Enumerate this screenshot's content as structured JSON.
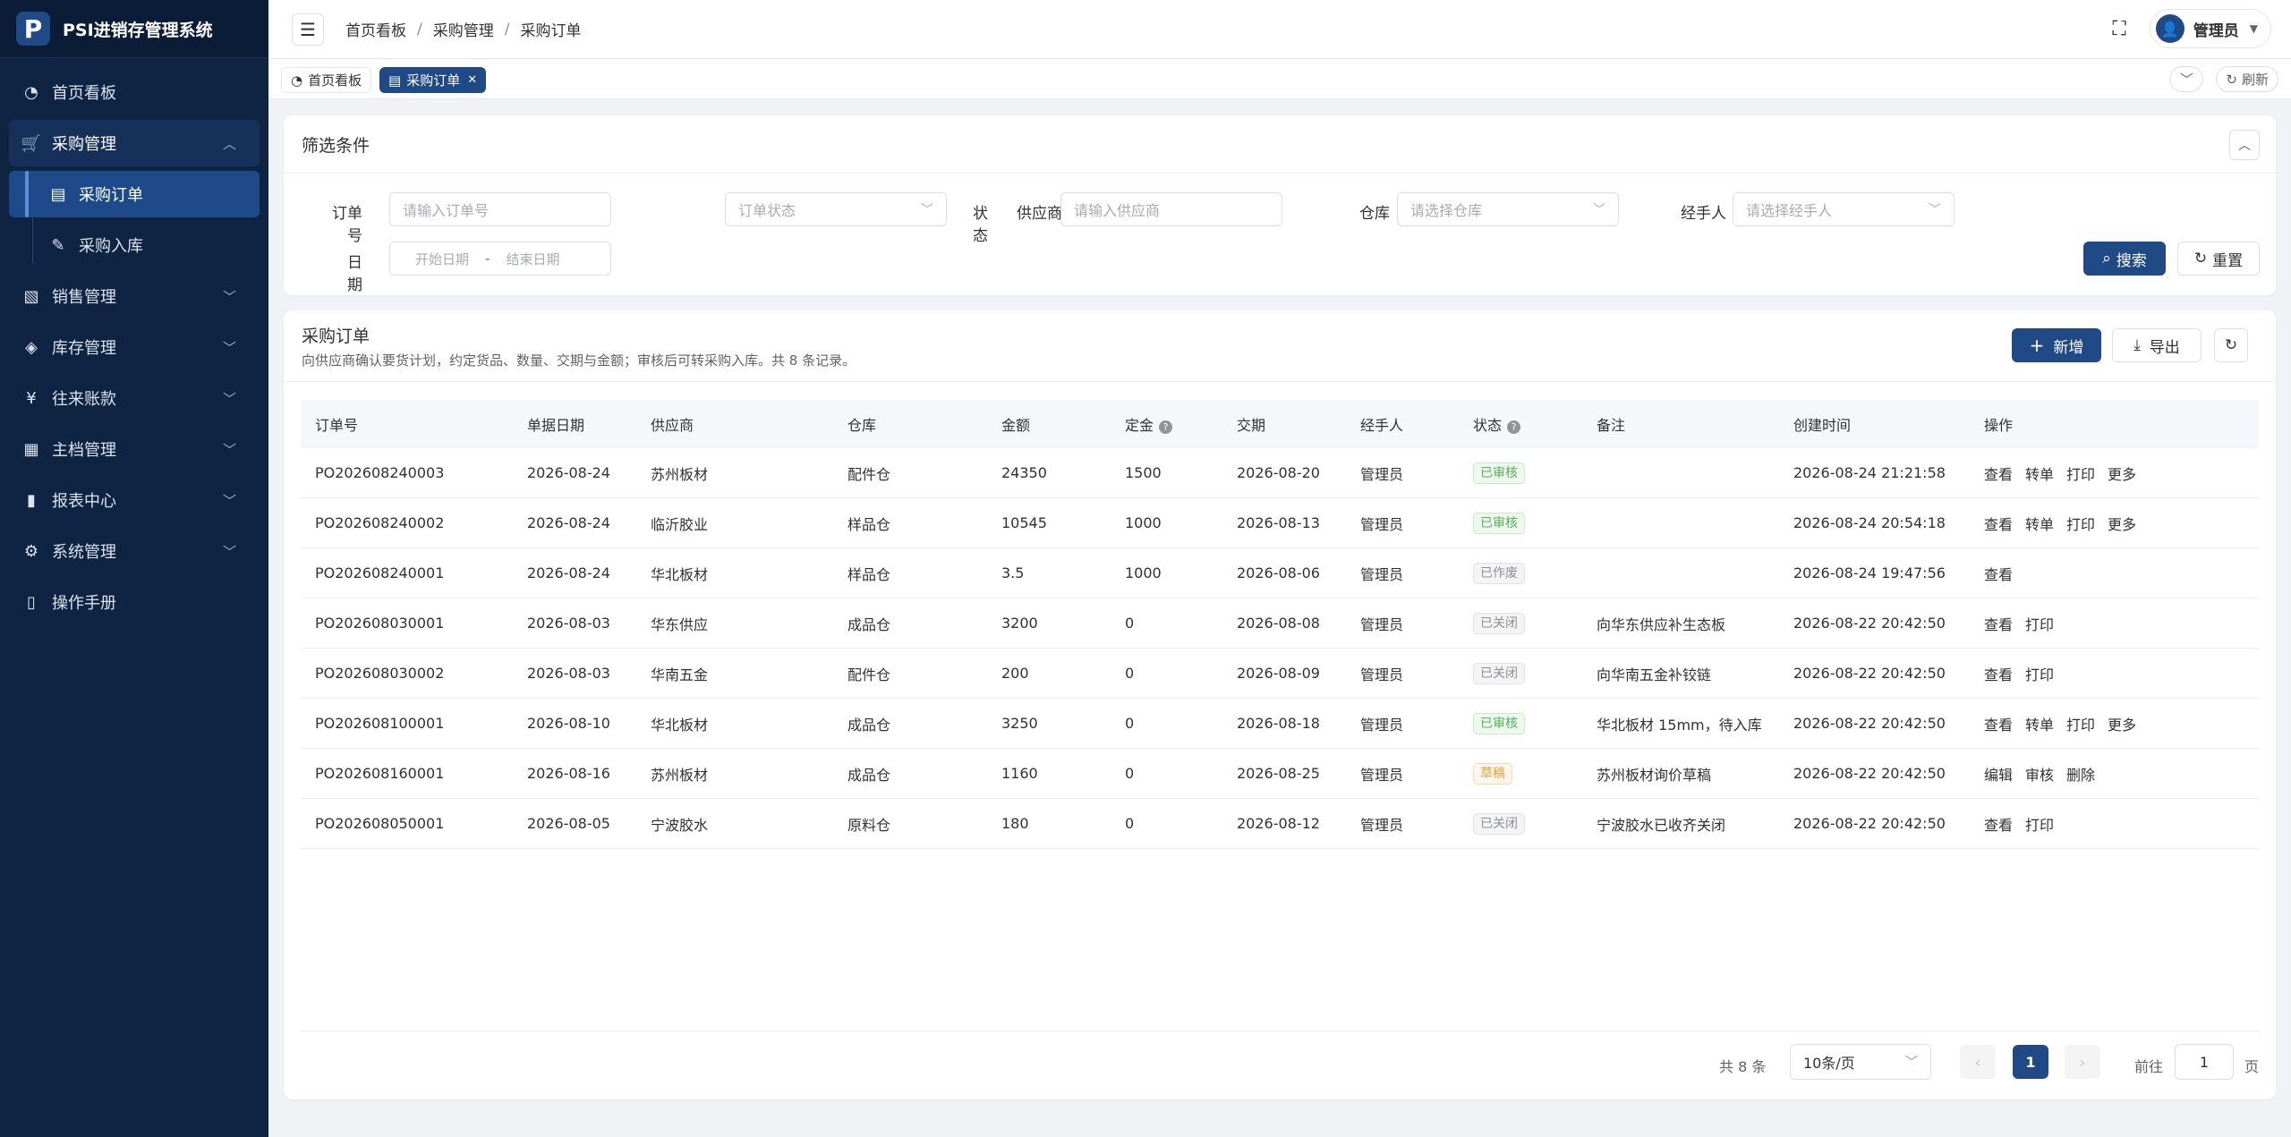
{
  "brand": {
    "logo": "P",
    "title": "PSI进销存管理系统"
  },
  "sidebar": {
    "items": [
      {
        "label": "首页看板",
        "icon": "dashboard-icon"
      },
      {
        "label": "采购管理",
        "icon": "cart-icon"
      },
      {
        "label": "销售管理",
        "icon": "sales-icon"
      },
      {
        "label": "库存管理",
        "icon": "stack-icon"
      },
      {
        "label": "往来账款",
        "icon": "yen-icon"
      },
      {
        "label": "主档管理",
        "icon": "archive-icon"
      },
      {
        "label": "报表中心",
        "icon": "chart-icon"
      },
      {
        "label": "系统管理",
        "icon": "gear-icon"
      },
      {
        "label": "操作手册",
        "icon": "book-icon"
      }
    ],
    "sub": [
      {
        "label": "采购订单",
        "icon": "doc-icon"
      },
      {
        "label": "采购入库",
        "icon": "edit-icon"
      }
    ]
  },
  "header": {
    "breadcrumb": [
      "首页看板",
      "采购管理",
      "采购订单"
    ],
    "sep": "/",
    "user": "管理员"
  },
  "tags": {
    "home": "首页看板",
    "current": "采购订单",
    "refresh": "刷新"
  },
  "filter": {
    "title": "筛选条件",
    "order_no_label": "订单号",
    "order_no_ph": "请输入订单号",
    "status_label": "状态",
    "status_ph": "订单状态",
    "supplier_label": "供应商",
    "supplier_ph": "请输入供应商",
    "warehouse_label": "仓库",
    "warehouse_ph": "请选择仓库",
    "handler_label": "经手人",
    "handler_ph": "请选择经手人",
    "date_label": "日期",
    "date_start": "开始日期",
    "date_sep": "-",
    "date_end": "结束日期",
    "search": "搜索",
    "reset": "重置"
  },
  "list": {
    "title": "采购订单",
    "desc": "向供应商确认要货计划，约定货品、数量、交期与金额；审核后可转采购入库。共 8 条记录。",
    "add": "新增",
    "export": "导出"
  },
  "table": {
    "columns": [
      "订单号",
      "单据日期",
      "供应商",
      "仓库",
      "金额",
      "定金",
      "交期",
      "经手人",
      "状态",
      "备注",
      "创建时间",
      "操作"
    ],
    "rows": [
      {
        "no": "PO202608240003",
        "date": "2026-08-24",
        "supplier": "苏州板材",
        "wh": "配件仓",
        "amount": "24350",
        "deposit": "1500",
        "due": "2026-08-20",
        "handler": "管理员",
        "status": "已审核",
        "st": "green",
        "remark": "",
        "created": "2026-08-24 21:21:58",
        "ops": [
          "查看",
          "转单",
          "打印",
          "更多"
        ]
      },
      {
        "no": "PO202608240002",
        "date": "2026-08-24",
        "supplier": "临沂胶业",
        "wh": "样品仓",
        "amount": "10545",
        "deposit": "1000",
        "due": "2026-08-13",
        "handler": "管理员",
        "status": "已审核",
        "st": "green",
        "remark": "",
        "created": "2026-08-24 20:54:18",
        "ops": [
          "查看",
          "转单",
          "打印",
          "更多"
        ]
      },
      {
        "no": "PO202608240001",
        "date": "2026-08-24",
        "supplier": "华北板材",
        "wh": "样品仓",
        "amount": "3.5",
        "deposit": "1000",
        "due": "2026-08-06",
        "handler": "管理员",
        "status": "已作废",
        "st": "gray",
        "remark": "",
        "created": "2026-08-24 19:47:56",
        "ops": [
          "查看"
        ]
      },
      {
        "no": "PO202608030001",
        "date": "2026-08-03",
        "supplier": "华东供应",
        "wh": "成品仓",
        "amount": "3200",
        "deposit": "0",
        "due": "2026-08-08",
        "handler": "管理员",
        "status": "已关闭",
        "st": "gray",
        "remark": "向华东供应补生态板",
        "created": "2026-08-22 20:42:50",
        "ops": [
          "查看",
          "打印"
        ]
      },
      {
        "no": "PO202608030002",
        "date": "2026-08-03",
        "supplier": "华南五金",
        "wh": "配件仓",
        "amount": "200",
        "deposit": "0",
        "due": "2026-08-09",
        "handler": "管理员",
        "status": "已关闭",
        "st": "gray",
        "remark": "向华南五金补铰链",
        "created": "2026-08-22 20:42:50",
        "ops": [
          "查看",
          "打印"
        ]
      },
      {
        "no": "PO202608100001",
        "date": "2026-08-10",
        "supplier": "华北板材",
        "wh": "成品仓",
        "amount": "3250",
        "deposit": "0",
        "due": "2026-08-18",
        "handler": "管理员",
        "status": "已审核",
        "st": "green",
        "remark": "华北板材 15mm，待入库",
        "created": "2026-08-22 20:42:50",
        "ops": [
          "查看",
          "转单",
          "打印",
          "更多"
        ]
      },
      {
        "no": "PO202608160001",
        "date": "2026-08-16",
        "supplier": "苏州板材",
        "wh": "成品仓",
        "amount": "1160",
        "deposit": "0",
        "due": "2026-08-25",
        "handler": "管理员",
        "status": "草稿",
        "st": "orange",
        "remark": "苏州板材询价草稿",
        "created": "2026-08-22 20:42:50",
        "ops": [
          "编辑",
          "审核",
          "删除"
        ]
      },
      {
        "no": "PO202608050001",
        "date": "2026-08-05",
        "supplier": "宁波胶水",
        "wh": "原料仓",
        "amount": "180",
        "deposit": "0",
        "due": "2026-08-12",
        "handler": "管理员",
        "status": "已关闭",
        "st": "gray",
        "remark": "宁波胶水已收齐关闭",
        "created": "2026-08-22 20:42:50",
        "ops": [
          "查看",
          "打印"
        ]
      }
    ]
  },
  "pager": {
    "total": "共 8 条",
    "size": "10条/页",
    "current": "1",
    "goto": "前往",
    "goto_value": "1",
    "page": "页"
  },
  "colors": {
    "primary": "#1f4a86",
    "sidebar": "#0f2343"
  }
}
